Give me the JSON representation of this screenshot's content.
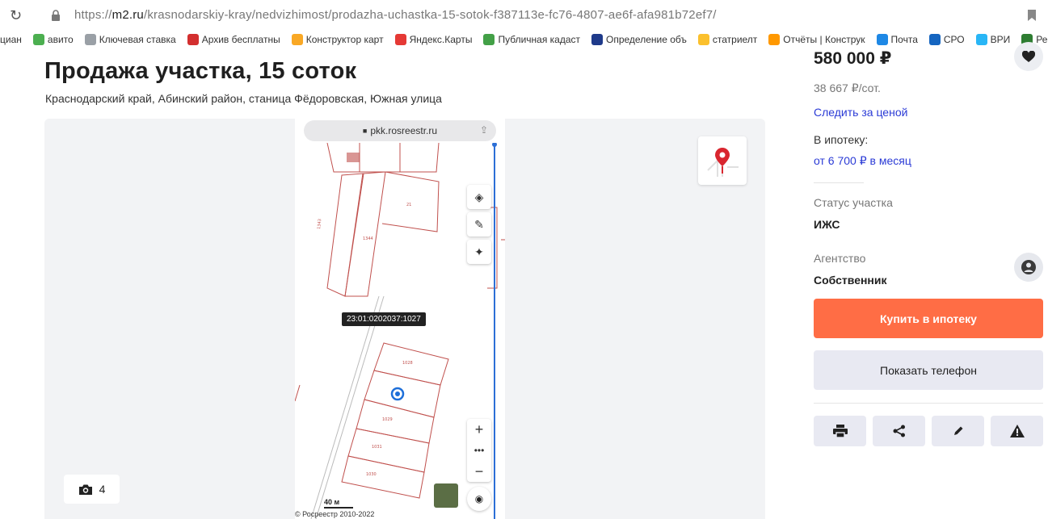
{
  "browser": {
    "url_prefix": "https://",
    "url_domain": "m2.ru",
    "url_path": "/krasnodarskiy-kray/nedvizhimost/prodazha-uchastka-15-sotok-f387113e-fc76-4807-ae6f-afa981b72ef7/"
  },
  "bookmarks": [
    {
      "label": "циан",
      "color": ""
    },
    {
      "label": "авито",
      "color": "#4caf50"
    },
    {
      "label": "Ключевая ставка",
      "color": "#9aa0a6"
    },
    {
      "label": "Архив бесплатны",
      "color": "#d32f2f"
    },
    {
      "label": "Конструктор карт",
      "color": "#f9a825"
    },
    {
      "label": "Яндекс.Карты",
      "color": "#e53935"
    },
    {
      "label": "Публичная кадаст",
      "color": "#43a047"
    },
    {
      "label": "Определение объ",
      "color": "#1e3a8a"
    },
    {
      "label": "статриелт",
      "color": "#fbc02d"
    },
    {
      "label": "Отчёты | Конструк",
      "color": "#ff9800"
    },
    {
      "label": "Почта",
      "color": "#1e88e5"
    },
    {
      "label": "СРО",
      "color": "#1565c0"
    },
    {
      "label": "ВРИ",
      "color": "#29b6f6"
    },
    {
      "label": "Ре",
      "color": "#2e7d32"
    }
  ],
  "listing": {
    "title": "Продажа участка, 15 соток",
    "address": "Краснодарский край, Абинский район, станица Фёдоровская, Южная улица",
    "photo_count": "4"
  },
  "map": {
    "site": "pkk.rosreestr.ru",
    "cadastral_number": "23:01:0202037:1027",
    "scale": "40 м",
    "copyright": "© Росреестр 2010-2022",
    "plot_labels": [
      "1343",
      "1344",
      "21",
      "1028",
      "1029",
      "1031",
      "1030"
    ]
  },
  "sidebar": {
    "price": "580 000 ₽",
    "price_per": "38 667 ₽/сот.",
    "watch_price": "Следить за ценой",
    "mortgage_label": "В ипотеку:",
    "mortgage_value": "от 6 700 ₽ в месяц",
    "status_label": "Статус участка",
    "status_value": "ИЖС",
    "agency_label": "Агентство",
    "agency_value": "Собственник",
    "buy_mortgage": "Купить в ипотеку",
    "show_phone": "Показать телефон"
  },
  "colors": {
    "accent": "#ff6d45",
    "link": "#2b3bd6",
    "plot_outline": "#c0504d"
  }
}
